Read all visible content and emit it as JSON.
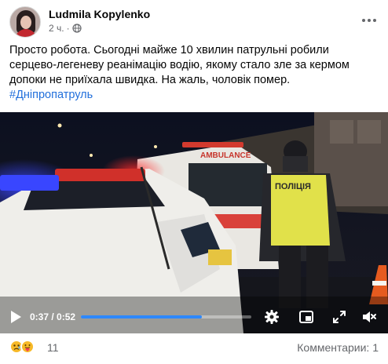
{
  "post": {
    "author": "Ludmila Kopylenko",
    "time": "2 ч.",
    "separator": "·",
    "audience_icon": "globe-icon",
    "more_icon": "more-horizontal-icon",
    "text_lines": [
      "Просто робота. Сьогодні майже 10 хвилин патрульні робили",
      "серцево-легеневу реанімацію водію, якому стало зле за кермом",
      "допоки не приїхала швидка. На жаль, чоловік помер."
    ],
    "hashtag": "#Дніпропатруль"
  },
  "video": {
    "ambulance_text": "AMBULANCE",
    "vest_text": "ПОЛІЦІЯ",
    "current_time": "0:37",
    "time_separator": " / ",
    "duration": "0:52",
    "progress": 0.71,
    "controls": [
      "play-icon",
      "settings-gear-icon",
      "picture-in-picture-icon",
      "fullscreen-icon",
      "volume-muted-icon"
    ]
  },
  "footer": {
    "reactions": [
      "sad-reaction-icon",
      "care-reaction-icon"
    ],
    "reaction_count": "11",
    "comments_label": "Комментарии: 1"
  },
  "colors": {
    "link": "#216fdb",
    "progress": "#2d88ff",
    "muted_text": "#65676b"
  }
}
